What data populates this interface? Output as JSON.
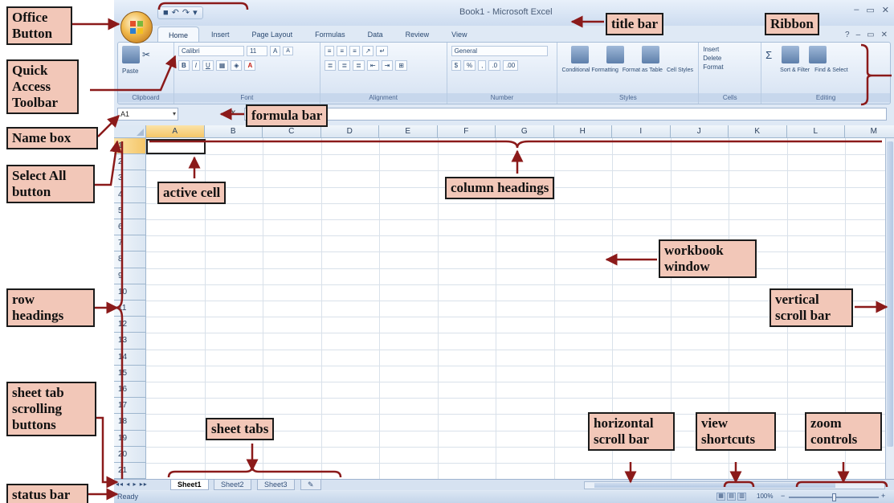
{
  "window": {
    "app_title": "Book1 - Microsoft Excel",
    "qat_icons": [
      "save-icon",
      "undo-icon",
      "redo-icon",
      "customize-icon"
    ],
    "controls": [
      "–",
      "▭",
      "✕"
    ]
  },
  "ribbon": {
    "tabs": [
      "Home",
      "Insert",
      "Page Layout",
      "Formulas",
      "Data",
      "Review",
      "View"
    ],
    "controls": [
      "?",
      "–",
      "▭",
      "✕"
    ],
    "clipboard": {
      "paste": "Paste",
      "label": "Clipboard"
    },
    "font": {
      "name": "Calibri",
      "size": "11",
      "grow": "A",
      "shrink": "A",
      "bold": "B",
      "italic": "I",
      "underline": "U",
      "label": "Font"
    },
    "alignment": {
      "label": "Alignment"
    },
    "number": {
      "format": "General",
      "currency": "$",
      "percent": "%",
      "comma": ",",
      "label": "Number"
    },
    "styles": {
      "conditional": "Conditional Formatting",
      "table": "Format as Table",
      "cell": "Cell Styles",
      "label": "Styles"
    },
    "cells": {
      "insert": "Insert",
      "delete": "Delete",
      "format": "Format",
      "label": "Cells"
    },
    "editing": {
      "sum": "Σ",
      "sort": "Sort & Filter",
      "find": "Find & Select",
      "label": "Editing"
    }
  },
  "formula_bar": {
    "name_box": "A1",
    "fx": "fx",
    "value": ""
  },
  "grid": {
    "columns": [
      "A",
      "B",
      "C",
      "D",
      "E",
      "F",
      "G",
      "H",
      "I",
      "J",
      "K",
      "L",
      "M"
    ],
    "rows": [
      "1",
      "2",
      "3",
      "4",
      "5",
      "6",
      "7",
      "8",
      "9",
      "10",
      "11",
      "12",
      "13",
      "14",
      "15",
      "16",
      "17",
      "18",
      "19",
      "20",
      "21"
    ],
    "active_cell": "A1"
  },
  "sheets": {
    "tabs": [
      "Sheet1",
      "Sheet2",
      "Sheet3"
    ],
    "active": "Sheet1",
    "scroll_buttons": "◂◂ ◂ ▸ ▸▸"
  },
  "status": {
    "text": "Ready",
    "zoom": "100%",
    "zoom_fraction": 0.5
  },
  "callouts": {
    "office_button": "Office Button",
    "quick_access": "Quick Access Toolbar",
    "name_box": "Name box",
    "select_all": "Select All button",
    "row_headings": "row headings",
    "sheet_tab_scrolling": "sheet tab scrolling buttons",
    "status_bar": "status bar",
    "title_bar": "title bar",
    "ribbon": "Ribbon",
    "formula_bar": "formula bar",
    "active_cell": "active cell",
    "column_headings": "column headings",
    "workbook_window": "workbook window",
    "vertical_scroll": "vertical scroll bar",
    "sheet_tabs": "sheet tabs",
    "horizontal_scroll": "horizontal scroll bar",
    "view_shortcuts": "view shortcuts",
    "zoom_controls": "zoom controls"
  }
}
